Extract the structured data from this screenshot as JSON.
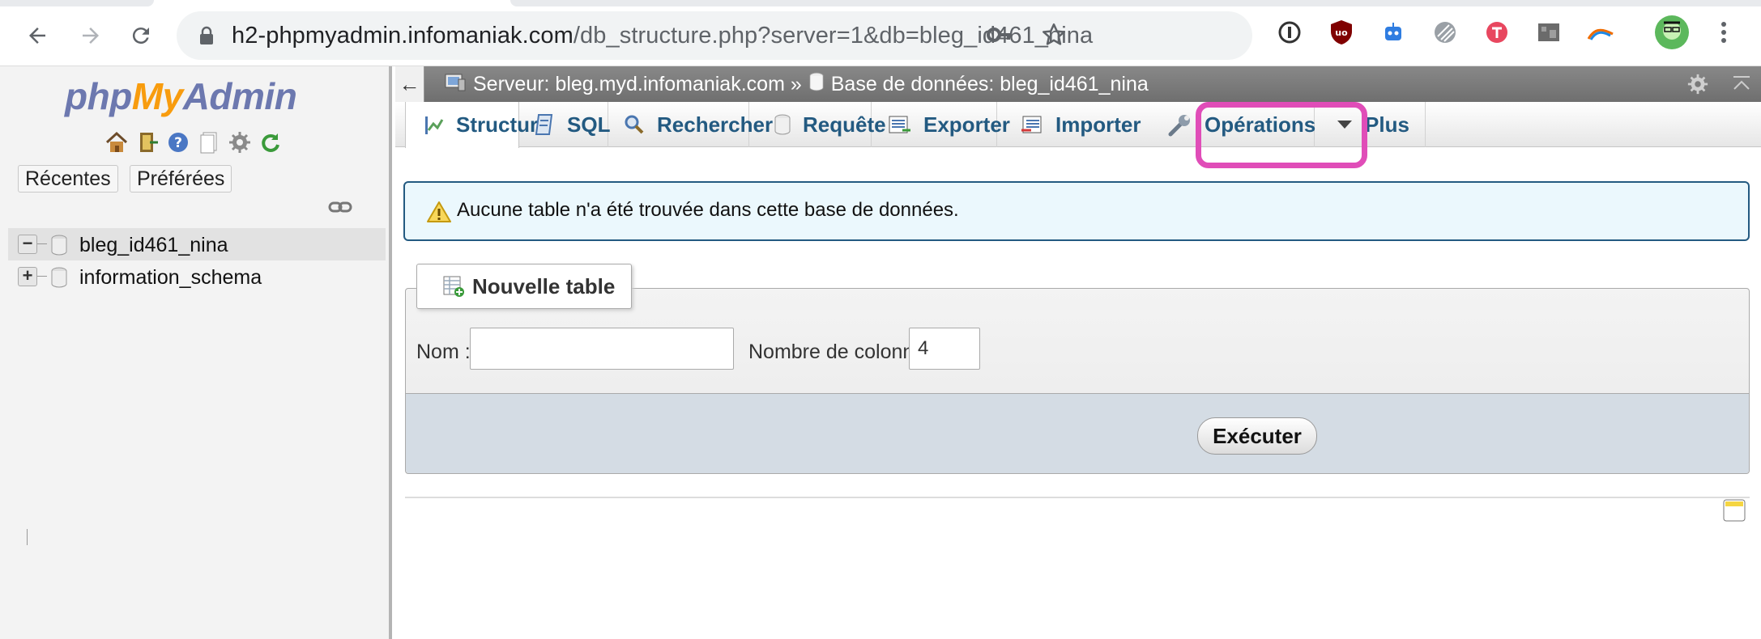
{
  "browser": {
    "url_host": "h2-phpmyadmin.infomaniak.com",
    "url_path": "/db_structure.php?server=1&db=bleg_id461_nina"
  },
  "sidebar": {
    "logo": {
      "php": "php",
      "my": "My",
      "admin": "Admin"
    },
    "buttons": {
      "recent": "Récentes",
      "favorites": "Préférées"
    },
    "databases": [
      {
        "name": "bleg_id461_nina",
        "expander": "−",
        "selected": true
      },
      {
        "name": "information_schema",
        "expander": "+",
        "selected": false
      }
    ]
  },
  "breadcrumb": {
    "server": "Serveur: bleg.myd.infomaniak.com »",
    "database": "Base de données: bleg_id461_nina"
  },
  "tabs": [
    {
      "label": "Structure",
      "icon": "structure-icon",
      "active": true
    },
    {
      "label": "SQL",
      "icon": "sql-icon"
    },
    {
      "label": "Rechercher",
      "icon": "search-icon"
    },
    {
      "label": "Requête",
      "icon": "query-icon"
    },
    {
      "label": "Exporter",
      "icon": "export-icon"
    },
    {
      "label": "Importer",
      "icon": "import-icon",
      "highlighted": true
    },
    {
      "label": "Opérations",
      "icon": "wrench-icon"
    },
    {
      "label": "Plus",
      "icon": "caret-down-icon"
    }
  ],
  "notice": {
    "message": "Aucune table n'a été trouvée dans cette base de données."
  },
  "create_table": {
    "legend": "Nouvelle table",
    "name_label": "Nom :",
    "name_value": "",
    "columns_label": "Nombre de colonnes :",
    "columns_value": "4",
    "submit_label": "Exécuter"
  },
  "colors": {
    "highlight": "#e04db8",
    "link": "#235a81",
    "notice_border": "#235a81"
  }
}
